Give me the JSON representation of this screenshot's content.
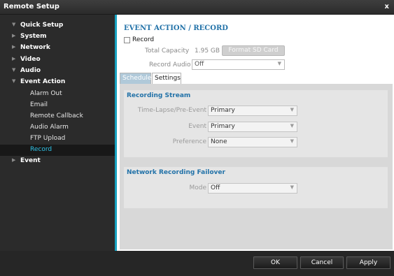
{
  "window": {
    "title": "Remote Setup",
    "close_label": "x"
  },
  "sidebar": {
    "items": [
      {
        "label": "Quick Setup",
        "arrow": "▼"
      },
      {
        "label": "System",
        "arrow": "▶"
      },
      {
        "label": "Network",
        "arrow": "▶"
      },
      {
        "label": "Video",
        "arrow": "▶"
      },
      {
        "label": "Audio",
        "arrow": "▼"
      },
      {
        "label": "Event Action",
        "arrow": "▼"
      },
      {
        "label": "Alarm Out"
      },
      {
        "label": "Email"
      },
      {
        "label": "Remote Callback"
      },
      {
        "label": "Audio Alarm"
      },
      {
        "label": "FTP Upload"
      },
      {
        "label": "Record"
      },
      {
        "label": "Event",
        "arrow": "▶"
      }
    ]
  },
  "main": {
    "heading": "EVENT ACTION / RECORD",
    "record_label": "Record",
    "total_capacity_label": "Total Capacity",
    "total_capacity_value": "1.95 GB",
    "format_button": "Format SD Card",
    "record_audio_label": "Record Audio",
    "record_audio_value": "Off",
    "tabs": [
      {
        "label": "Schedule"
      },
      {
        "label": "Settings"
      }
    ],
    "recording_stream": {
      "title": "Recording Stream",
      "timelapse_label": "Time-Lapse/Pre-Event",
      "timelapse_value": "Primary",
      "event_label": "Event",
      "event_value": "Primary",
      "preference_label": "Preference",
      "preference_value": "None"
    },
    "failover": {
      "title": "Network Recording Failover",
      "mode_label": "Mode",
      "mode_value": "Off"
    }
  },
  "footer": {
    "ok": "OK",
    "cancel": "Cancel",
    "apply": "Apply"
  }
}
